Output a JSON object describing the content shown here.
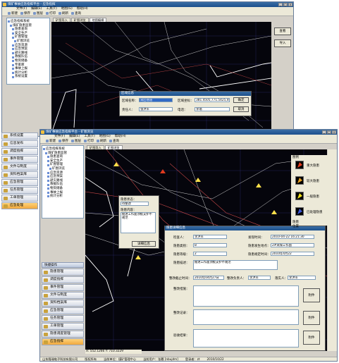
{
  "back_window": {
    "title": "煤矿事故应急指挥平台 - 应急指挥",
    "menu": [
      "文件(F)",
      "编辑(E)",
      "工具(T)",
      "地图(G)",
      "帮助(H)"
    ],
    "toolbar": [
      "新建",
      "保存",
      "图层",
      "打印",
      "刷新",
      "查询"
    ],
    "tabs": [
      "矿图导入",
      "矿图浏览",
      "地图编辑"
    ],
    "tree": [
      "应急指挥系统",
      "煤矿隐患监管",
      "隐患查询",
      "安全生产",
      "矿图管理",
      "矿图浏览",
      "应急资源",
      "应急预案",
      "避灾路线",
      "救援队伍",
      "物资储备",
      "专家库",
      "事故上报",
      "统计分析",
      "系统设置"
    ],
    "buttons": [
      "查看",
      "导入"
    ],
    "dialog": {
      "title": "区域信息",
      "area_name_label": "区域名称：",
      "area_name_value": "采区巷道",
      "coords_label": "区域坐标：",
      "coords_value": "381.4505,771.5425,468.3308",
      "owner_label": "责任人：",
      "owner_value": "张洪军",
      "phone_label": "电话：",
      "phone_value": "李瑞",
      "ok_label": "确定",
      "cancel_label": "取消"
    }
  },
  "front_window": {
    "title": "煤矿事故应急指挥平台 - 矿图浏览",
    "menu": [
      "文件(F)",
      "编辑(E)",
      "工具(T)",
      "地图(G)",
      "帮助(H)"
    ],
    "toolbar": [
      "新建",
      "保存",
      "图层",
      "打印",
      "刷新",
      "查询"
    ],
    "tabs": [
      "矿图导入",
      "矿图浏览"
    ],
    "tree": [
      "应急指挥系统",
      "煤矿隐患监管",
      "隐患查询",
      "安全生产",
      "矿图管理",
      "矿图浏览",
      "应急资源",
      "应急预案",
      "避灾路线",
      "救援队伍",
      "物资储备",
      "事故上报",
      "统计分析"
    ],
    "left_nav": [
      "系统设置",
      "信息发布",
      "调度指挥",
      "事件管理",
      "文件与制度",
      "资料档案库",
      "应急管理",
      "任务管理",
      "工单管理",
      "应急处理"
    ],
    "bottom_nav_header": "快捷操作",
    "bottom_nav": [
      "隐患管理",
      "调度指挥",
      "事件管理",
      "文件与制度",
      "资料档案库",
      "应急管理",
      "任务管理",
      "工单管理",
      "隐患调度管理",
      "应急指挥"
    ],
    "legend": {
      "title": "图例",
      "items": [
        {
          "label": "重大隐患",
          "color": "#e53c1e"
        },
        {
          "label": "较大隐患",
          "color": "#e8a020"
        },
        {
          "label": "一般隐患",
          "color": "#f2e21c"
        },
        {
          "label": "已处理隐患",
          "color": "#3c56d6"
        }
      ],
      "caption": "隐患\n位置"
    },
    "popup": {
      "title": "隐患状态",
      "state_label": "隐患状态：",
      "state_value": "待整改",
      "content_label": "隐患内容：",
      "content_value": "掘进工作面顶板支护不规范",
      "button": "详细信息"
    },
    "detail_dialog": {
      "title": "隐患详细信息",
      "fields": [
        {
          "label": "检查人：",
          "value": "李洪军"
        },
        {
          "label": "发现时间：",
          "value": "2010-04-22 16:21:30"
        },
        {
          "label": "隐患类别：",
          "value": "B"
        },
        {
          "label": "隐患发生地点：",
          "value": "2#采煤工作面"
        },
        {
          "label": "隐患等级：",
          "value": "2"
        },
        {
          "label": "隐患规定时间：",
          "value": "2010年4月22"
        },
        {
          "label": "隐患描述：",
          "value": "掘进工作面顶板支护不规范"
        },
        {
          "label": "整改截止时间：",
          "value": "2010年04月27日"
        },
        {
          "label": "整改负责人：",
          "value": "李洪军"
        },
        {
          "label": "落实人：",
          "value": "李洪军"
        }
      ],
      "area_labels": [
        "整改措施：",
        "整改记录：",
        "验收结果："
      ],
      "btn_label": "附件"
    },
    "status": {
      "coords": "X: 552.1266  Y: 710.3229",
      "scale": "比例尺",
      "company": "山东隆瑞电子科技有限公司",
      "version": "版权所有",
      "unit": "当前单位：煤矿管理中心",
      "user": "当前用户：张聂 [nbujdm]",
      "login": "登录者：zt",
      "date": "2010/10/22"
    }
  }
}
